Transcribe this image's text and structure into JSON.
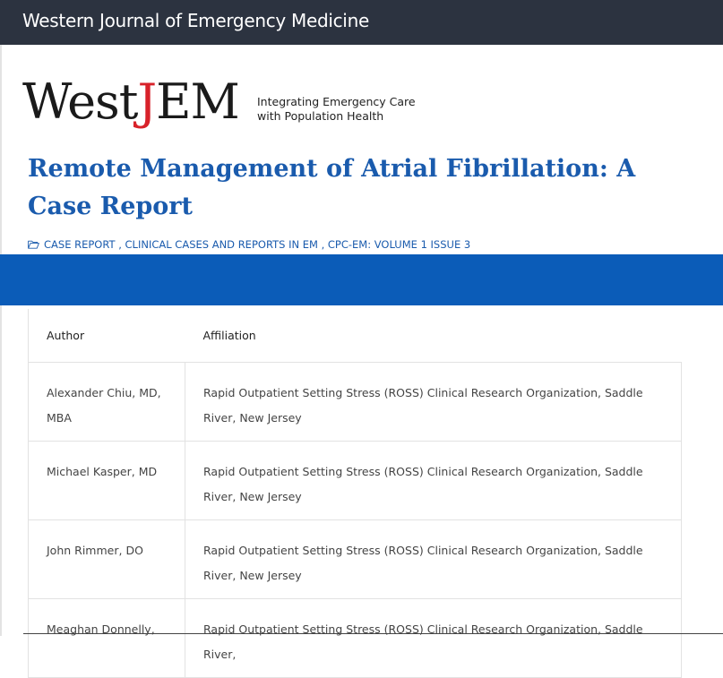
{
  "site": {
    "title": "Western Journal of Emergency Medicine"
  },
  "logo": {
    "wordmark_pre": "West",
    "wordmark_j": "J",
    "wordmark_post": "EM",
    "tagline_line1": "Integrating Emergency Care",
    "tagline_line2": "with Population Health",
    "accent_color": "#d8222a"
  },
  "article": {
    "title": "Remote Management of Atrial Fibrillation: A Case Report",
    "title_color": "#1a5bad",
    "categories": [
      {
        "label": "Case Report"
      },
      {
        "label": "Clinical Cases and Reports in EM"
      },
      {
        "label": "CPC-EM: Volume 1 Issue 3"
      }
    ],
    "category_separator": " , ",
    "category_icon": "folder-icon"
  },
  "band_color": "#0b5cb8",
  "topbar_color": "#2c3340",
  "authors_table": {
    "headers": {
      "author": "Author",
      "affiliation": "Affiliation"
    },
    "rows": [
      {
        "author": "Alexander Chiu, MD, MBA",
        "affiliation": "Rapid Outpatient Setting Stress (ROSS) Clinical Research Organization, Saddle River, New Jersey"
      },
      {
        "author": "Michael Kasper, MD",
        "affiliation": "Rapid Outpatient Setting Stress (ROSS) Clinical Research Organization, Saddle River, New Jersey"
      },
      {
        "author": "John Rimmer, DO",
        "affiliation": "Rapid Outpatient Setting Stress (ROSS) Clinical Research Organization, Saddle River, New Jersey"
      },
      {
        "author": "Meaghan Donnelly,",
        "affiliation": "Rapid Outpatient Setting Stress (ROSS) Clinical Research Organization, Saddle River,"
      }
    ]
  }
}
